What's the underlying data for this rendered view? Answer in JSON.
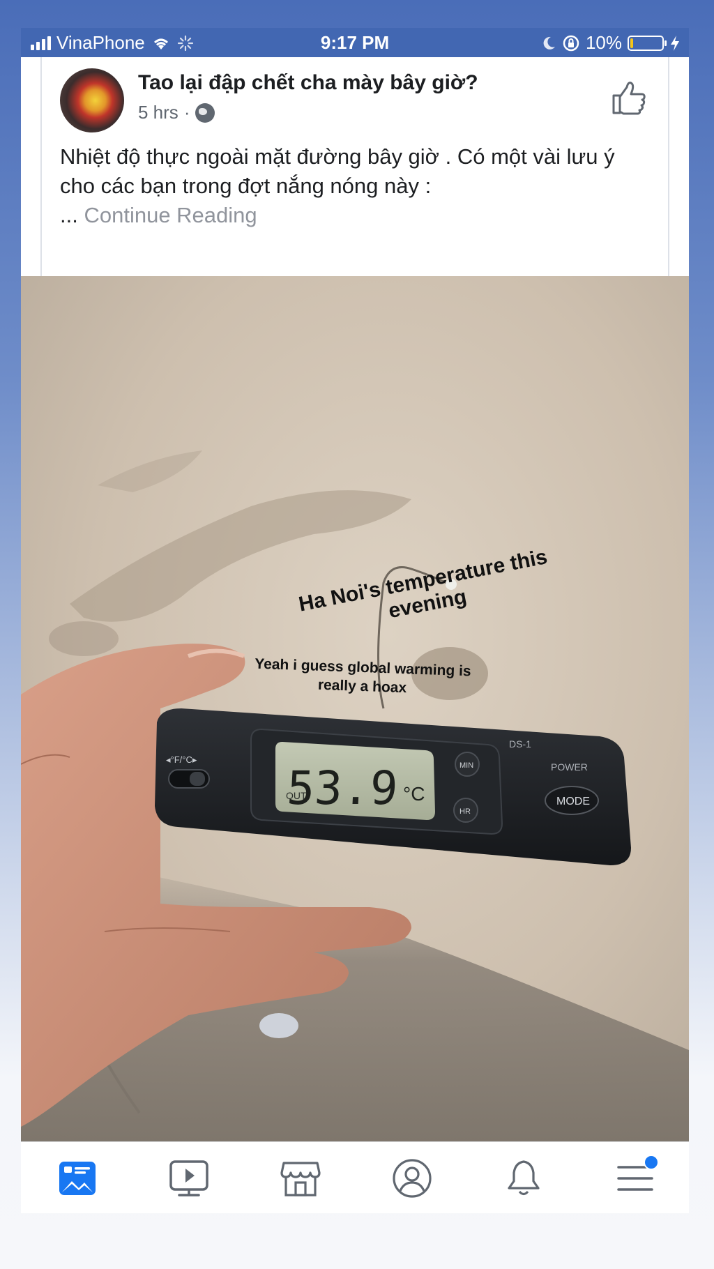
{
  "status_bar": {
    "carrier": "VinaPhone",
    "time": "9:17 PM",
    "battery": "10%",
    "battery_fill_fraction": 0.1
  },
  "post": {
    "author": "Tao lại đập chết cha mày bây giờ?",
    "time_ago": "5 hrs",
    "separator": "·",
    "text": "Nhiệt độ thực ngoài mặt đường bây giờ . Có một vài lưu ý cho các bạn trong đợt nắng nóng này :",
    "ellipsis": "...",
    "continue_label": "Continue Reading",
    "photo": {
      "caption_1": "Ha Noi's temperature this evening",
      "caption_2": "Yeah i guess global warming is really a hoax",
      "device_switch_label": "◂°F/°C▸",
      "display_prefix": "OUT",
      "display_value": "53.9",
      "display_unit": "°C",
      "model": "DS-1",
      "power_label": "POWER",
      "mode_label": "MODE",
      "min_label": "MIN",
      "hr_label": "HR"
    }
  },
  "tabbar": {
    "tabs": [
      {
        "name": "news-feed",
        "icon": "news-feed-icon",
        "active": true
      },
      {
        "name": "watch",
        "icon": "video-play-icon",
        "active": false
      },
      {
        "name": "marketplace",
        "icon": "marketplace-shop-icon",
        "active": false
      },
      {
        "name": "profile",
        "icon": "profile-icon",
        "active": false
      },
      {
        "name": "notifications",
        "icon": "bell-icon",
        "active": false
      },
      {
        "name": "menu",
        "icon": "hamburger-menu-icon",
        "active": false,
        "badge": true
      }
    ]
  },
  "colors": {
    "facebook_blue": "#4267b2",
    "active_tab": "#1877f2",
    "inactive_icon": "#606770"
  }
}
